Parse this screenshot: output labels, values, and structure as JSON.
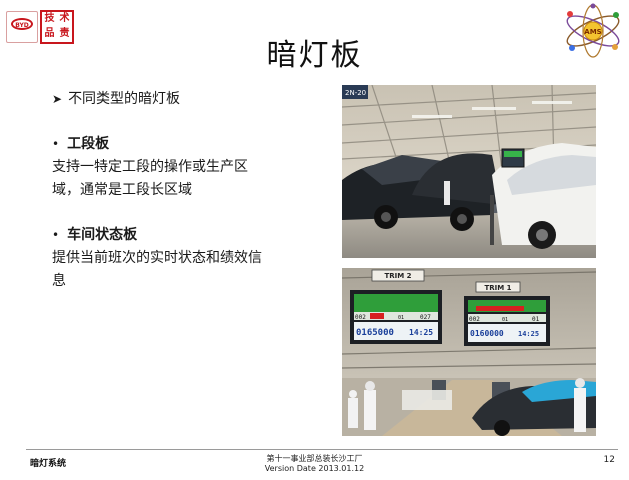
{
  "header": {
    "seal_chars": [
      "技",
      "术",
      "品",
      "责"
    ],
    "byd_text": "BYD",
    "ams_text": "AMS"
  },
  "slide": {
    "title": "暗灯板",
    "intro": "不同类型的暗灯板",
    "sections": [
      {
        "heading": "工段板",
        "description": "支持一特定工段的操作或生产区域，通常是工段长区域"
      },
      {
        "heading": "车间状态板",
        "description": "提供当前班次的实时状态和绩效信息"
      }
    ],
    "photos": [
      {
        "name": "assembly-line-photo",
        "sign": "2N-20"
      },
      {
        "name": "andon-board-photo",
        "boards": [
          {
            "sign": "TRIM 2",
            "left_num": "002",
            "mid_num": "01",
            "right_num": "027",
            "count": "0165000",
            "time": "14:25"
          },
          {
            "sign": "TRIM 1",
            "left_num": "002",
            "mid_num": "01",
            "right_num": "01",
            "count": "0160000",
            "time": "14:25"
          }
        ]
      }
    ]
  },
  "footer": {
    "left": "暗灯系统",
    "center_line1": "第十一事业部总装长沙工厂",
    "center_line2": "Version Date 2013.01.12",
    "page_number": "12"
  },
  "colors": {
    "brand_red": "#c8161d",
    "board_green": "#2f9e3a",
    "board_red": "#d62020",
    "counter_blue": "#1a3f9a"
  }
}
